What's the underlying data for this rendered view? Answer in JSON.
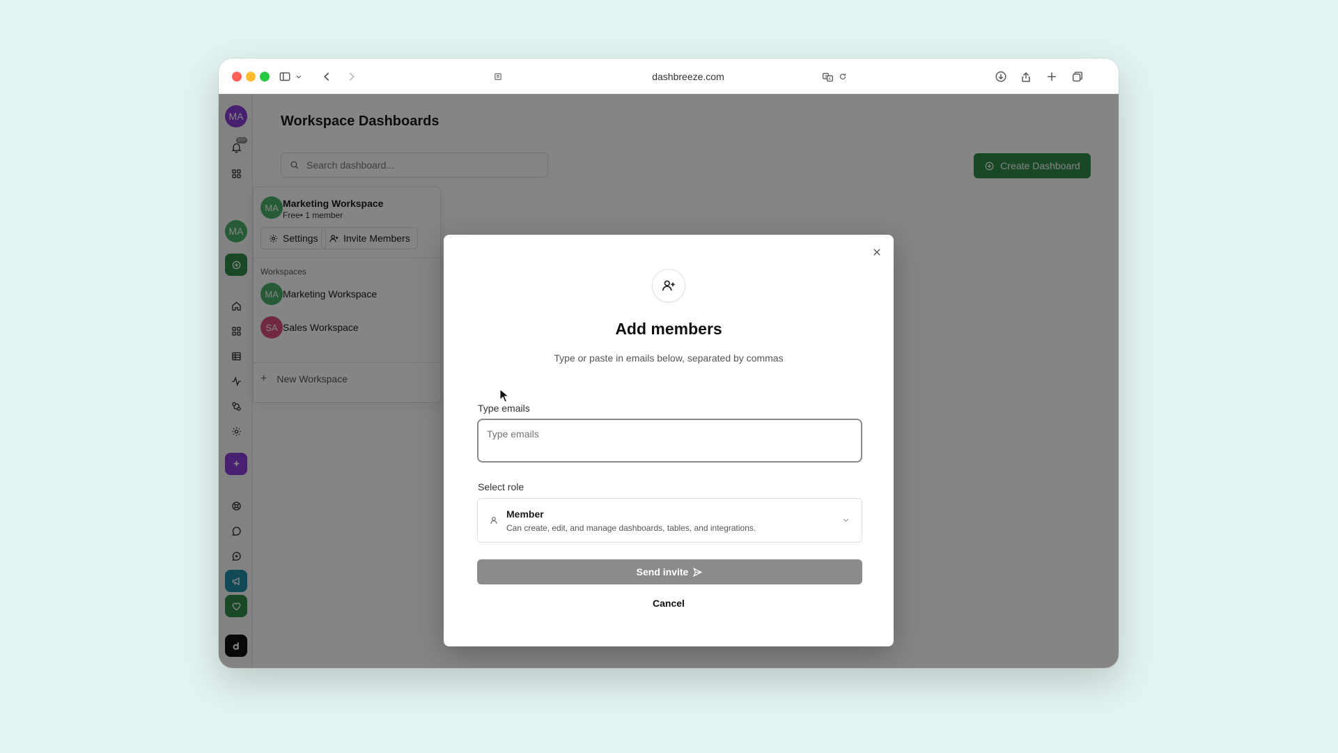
{
  "browser": {
    "url": "dashbreeze.com"
  },
  "rail": {
    "user_initials": "MA",
    "notification_badge": "10+",
    "workspace_initials": "MA"
  },
  "page": {
    "title": "Workspace Dashboards",
    "search_placeholder": "Search dashboard...",
    "create_button": "Create Dashboard"
  },
  "workspace_panel": {
    "current": {
      "initials": "MA",
      "name": "Marketing Workspace",
      "plan": "Free• 1 member"
    },
    "settings_button": "Settings",
    "invite_button": "Invite Members",
    "section_label": "Workspaces",
    "items": [
      {
        "initials": "MA",
        "name": "Marketing Workspace",
        "color": "#4caf6a"
      },
      {
        "initials": "SA",
        "name": "Sales Workspace",
        "color": "#d9507a"
      }
    ],
    "new_workspace": "New Workspace"
  },
  "modal": {
    "title": "Add members",
    "subtitle": "Type or paste in emails below, separated by commas",
    "emails_label": "Type emails",
    "emails_placeholder": "Type emails",
    "role_label": "Select role",
    "role": {
      "title": "Member",
      "description": "Can create, edit, and manage dashboards, tables, and integrations."
    },
    "send_button": "Send invite",
    "cancel_button": "Cancel"
  },
  "colors": {
    "brand_green": "#2e8a4a",
    "avatar_purple": "#8a3fd6",
    "avatar_green": "#4caf6a",
    "avatar_pink": "#d9507a"
  }
}
